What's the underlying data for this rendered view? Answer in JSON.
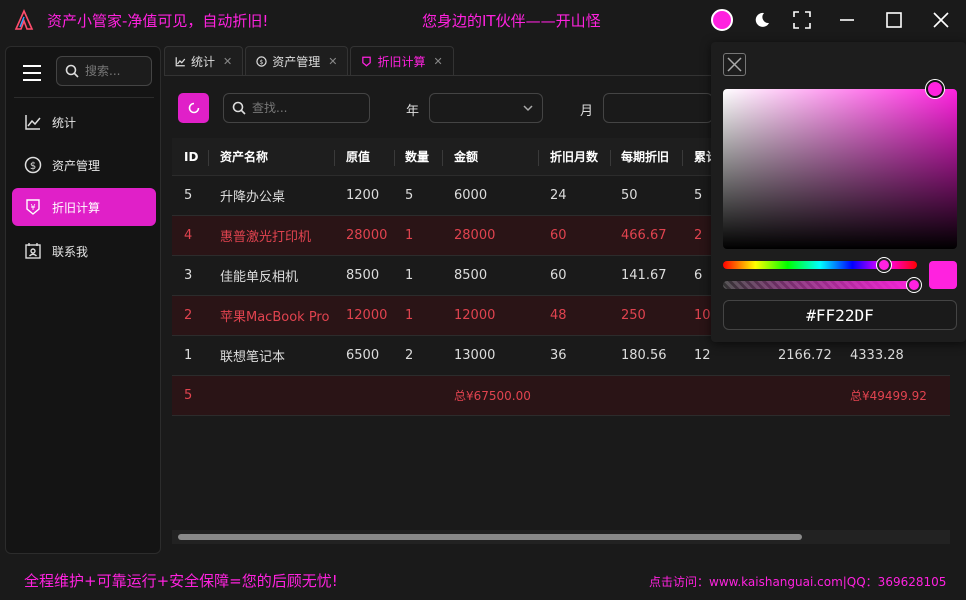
{
  "app": {
    "title": "资产小管家-净值可见，自动折旧!",
    "slogan": "您身边的IT伙伴——开山怪"
  },
  "colors": {
    "accent": "#ff22df",
    "active_bg": "#e020c8",
    "danger_text": "#e0434f",
    "danger_bg": "#2a1416"
  },
  "sidebar": {
    "search_placeholder": "搜索...",
    "items": [
      {
        "label": "统计",
        "icon": "line-chart-icon"
      },
      {
        "label": "资产管理",
        "icon": "dollar-circle-icon"
      },
      {
        "label": "折旧计算",
        "icon": "yen-shield-icon"
      },
      {
        "label": "联系我",
        "icon": "contact-card-icon"
      }
    ]
  },
  "tabs": [
    {
      "label": "统计"
    },
    {
      "label": "资产管理"
    },
    {
      "label": "折旧计算"
    }
  ],
  "toolbar": {
    "search_placeholder": "查找...",
    "year_label": "年",
    "month_label": "月"
  },
  "table": {
    "columns": [
      "ID",
      "资产名称",
      "原值",
      "数量",
      "金额",
      "折旧月数",
      "每期折旧",
      "累计"
    ],
    "rows": [
      {
        "id": "5",
        "name": "升降办公桌",
        "orig": "1200",
        "qty": "5",
        "amount": "6000",
        "months": "24",
        "per": "50",
        "acc": "5",
        "c9": "",
        "c10": ""
      },
      {
        "id": "4",
        "name": "惠普激光打印机",
        "orig": "28000",
        "qty": "1",
        "amount": "28000",
        "months": "60",
        "per": "466.67",
        "acc": "2",
        "c9": "",
        "c10": ""
      },
      {
        "id": "3",
        "name": "佳能单反相机",
        "orig": "8500",
        "qty": "1",
        "amount": "8500",
        "months": "60",
        "per": "141.67",
        "acc": "6",
        "c9": "",
        "c10": ""
      },
      {
        "id": "2",
        "name": "苹果MacBook Pro",
        "orig": "12000",
        "qty": "1",
        "amount": "12000",
        "months": "48",
        "per": "250",
        "acc": "10",
        "c9": "",
        "c10": ""
      },
      {
        "id": "1",
        "name": "联想笔记本",
        "orig": "6500",
        "qty": "2",
        "amount": "13000",
        "months": "36",
        "per": "180.56",
        "acc": "12",
        "c9": "2166.72",
        "c10": "4333.28"
      }
    ],
    "total": {
      "count": "5",
      "amount": "总¥67500.00",
      "net": "总¥49499.92"
    }
  },
  "color_picker": {
    "hex": "#FF22DF",
    "hue_level": 0.83,
    "alpha_level": 1.0
  },
  "status": {
    "left": "全程维护+可靠运行+安全保障=您的后顾无忧!",
    "right": "点击访问：www.kaishanguai.com|QQ：369628105"
  }
}
